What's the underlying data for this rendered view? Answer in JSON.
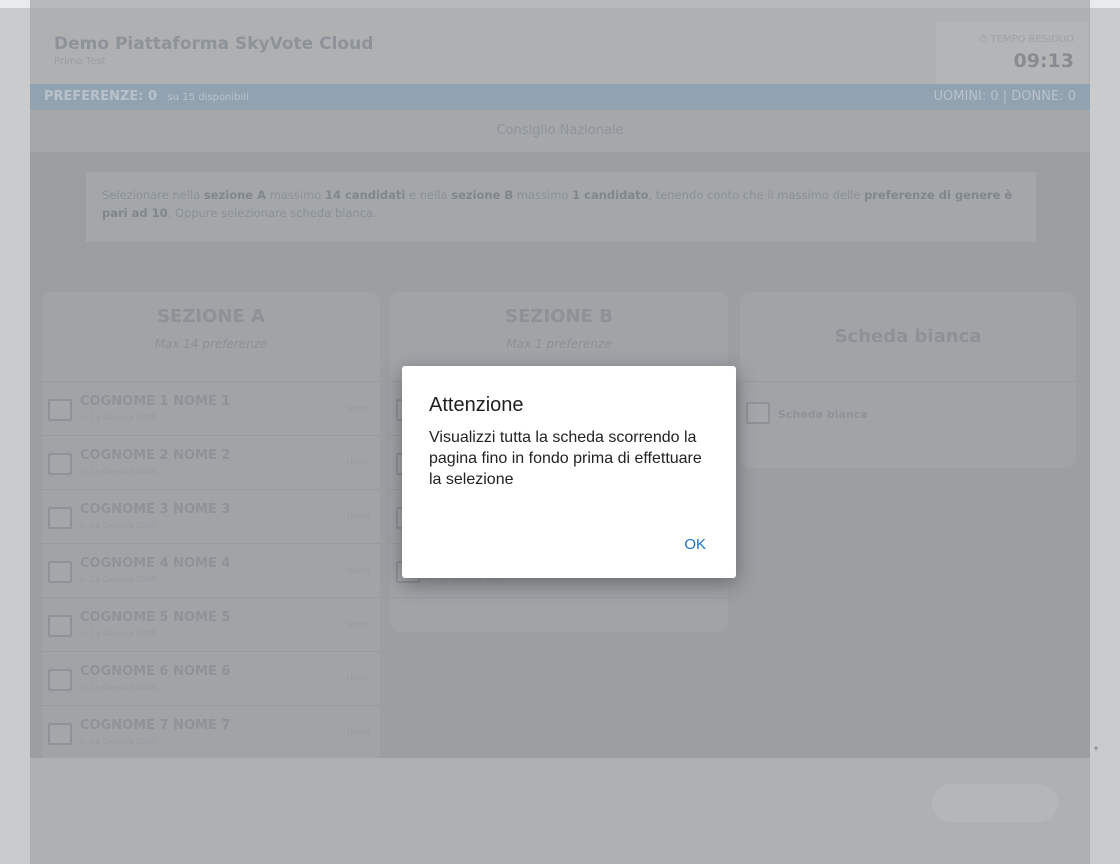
{
  "header": {
    "app_title": "Demo Piattaforma SkyVote Cloud",
    "app_subtitle": "Primo Test",
    "timer_label": "⏱ TEMPO RESIDUO",
    "timer_value": "09:13"
  },
  "preferences_bar": {
    "left_label": "PREFERENZE: 0",
    "left_note": "su 15 disponibili",
    "right_label": "UOMINI: 0 | DONNE: 0"
  },
  "section_title": "Consiglio Nazionale",
  "instructions": {
    "part1": "Selezionare nella ",
    "bold1": "sezione A",
    "part2": " massimo ",
    "bold2": "14 candidati",
    "part3": " e nella ",
    "bold3": "sezione B",
    "part4": " massimo ",
    "bold4": "1 candidato",
    "part5": ", tenendo conto che il massimo delle ",
    "bold5": "preferenze di genere è pari ad 10",
    "part6": ". Oppure selezionare scheda bianca."
  },
  "sections": {
    "a": {
      "title": "SEZIONE A",
      "subtitle": "Max 14 preferenze",
      "candidates": [
        {
          "name": "COGNOME 1 NOME 1",
          "born": "n. 1a Genova 2005",
          "tag": "Uomo"
        },
        {
          "name": "COGNOME 2 NOME 2",
          "born": "n. 1a Genova 2005",
          "tag": "Uomo"
        },
        {
          "name": "COGNOME 3 NOME 3",
          "born": "n. 1a Genova 2005",
          "tag": "Uomo"
        },
        {
          "name": "COGNOME 4 NOME 4",
          "born": "n. 1a Genova 2005",
          "tag": "Uomo"
        },
        {
          "name": "COGNOME 5 NOME 5",
          "born": "n. 1a Genova 2005",
          "tag": "Uomo"
        },
        {
          "name": "COGNOME 6 NOME 6",
          "born": "n. 1a Genova 2005",
          "tag": "Uomo"
        },
        {
          "name": "COGNOME 7 NOME 7",
          "born": "n. 1a Genova 2005",
          "tag": "Uomo"
        }
      ]
    },
    "b": {
      "title": "SEZIONE B",
      "subtitle": "Max 1 preferenze",
      "candidates": [
        {
          "name": "",
          "born": "",
          "tag": ""
        },
        {
          "name": "",
          "born": "",
          "tag": ""
        },
        {
          "name": "",
          "born": "",
          "tag": ""
        },
        {
          "name": "",
          "born": "n. 1a Genova 2005",
          "tag": ""
        }
      ]
    },
    "blank": {
      "title": "Scheda bianca",
      "option_label": "Scheda bianca"
    }
  },
  "dialog": {
    "title": "Attenzione",
    "message": "Visualizzi tutta la scheda scorrendo la pagina fino in fondo prima di effettuare la selezione",
    "ok_label": "OK"
  },
  "colors": {
    "ok_link": "#1a73c9",
    "preferences_bar": "#91a2b0"
  }
}
